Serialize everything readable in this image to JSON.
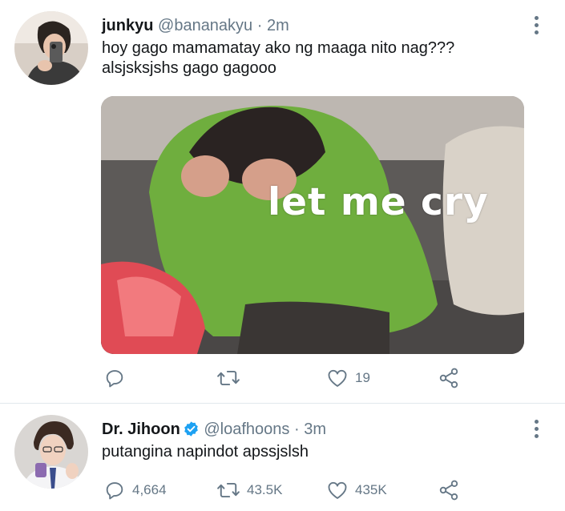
{
  "tweets": [
    {
      "user": {
        "display_name": "junkyu",
        "handle": "@bananakyu",
        "separator": "·",
        "time": "2m",
        "verified": false
      },
      "text_lines": [
        "hoy gago mamamatay ako ng maaga nito nag???",
        "alsjsksjshs gago gagooo"
      ],
      "media": {
        "caption": "let me cry"
      },
      "actions": {
        "replies": "",
        "retweets": "",
        "likes": "19"
      },
      "icons": [
        "reply-icon",
        "retweet-icon",
        "like-icon",
        "share-icon",
        "more-options-icon"
      ]
    },
    {
      "user": {
        "display_name": "Dr. Jihoon",
        "handle": "@loafhoons",
        "separator": "·",
        "time": "3m",
        "verified": true
      },
      "text_lines": [
        "putangina napindot apssjslsh"
      ],
      "actions": {
        "replies": "4,664",
        "retweets": "43.5K",
        "likes": "435K"
      },
      "icons": [
        "reply-icon",
        "retweet-icon",
        "like-icon",
        "share-icon",
        "more-options-icon",
        "verified-badge-icon"
      ]
    }
  ],
  "colors": {
    "text": "#14171a",
    "secondary": "#657786",
    "verified": "#1da1f2",
    "divider": "#e1e8ed"
  }
}
